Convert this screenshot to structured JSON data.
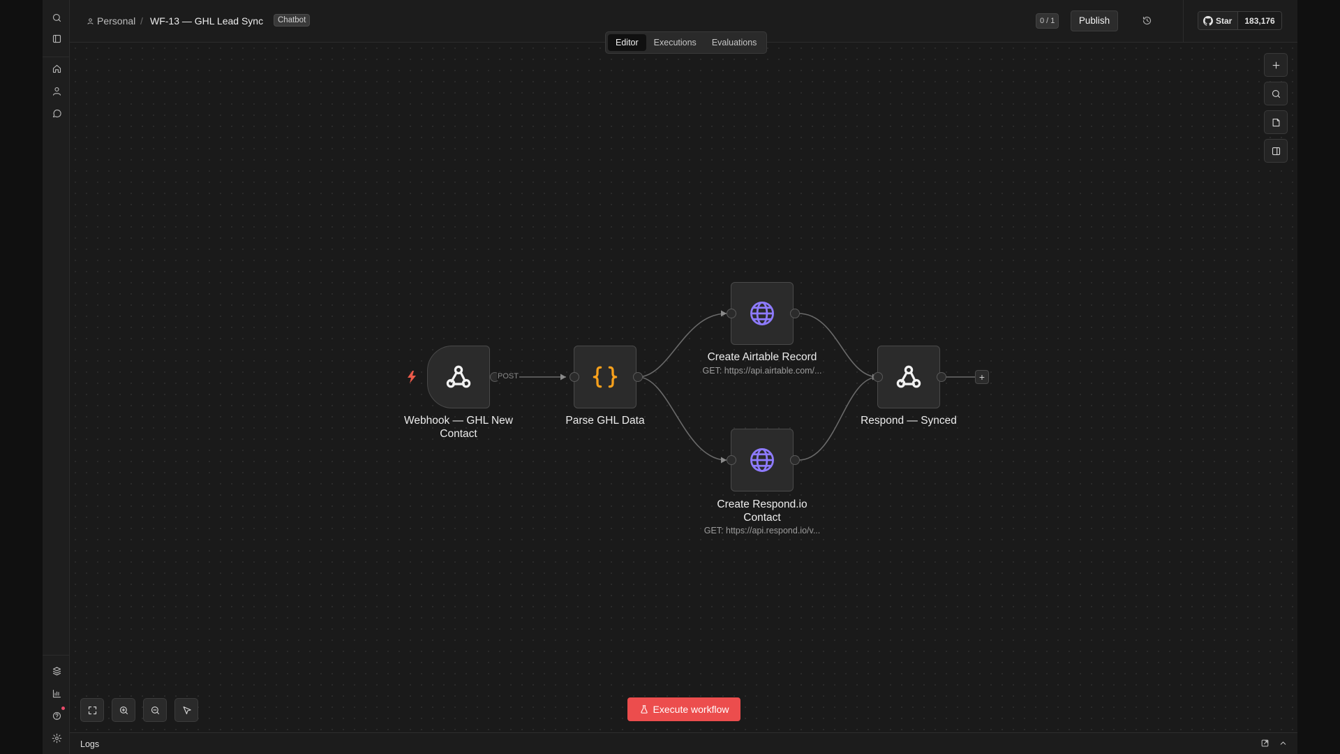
{
  "header": {
    "breadcrumb_owner": "Personal",
    "breadcrumb_separator": "/",
    "workflow_title": "WF-13 — GHL Lead Sync",
    "tag": "Chatbot",
    "version_badge": "0 / 1",
    "publish_label": "Publish",
    "github_star_label": "Star",
    "github_star_count": "183,176"
  },
  "tabs": [
    {
      "label": "Editor",
      "active": true
    },
    {
      "label": "Executions",
      "active": false
    },
    {
      "label": "Evaluations",
      "active": false
    }
  ],
  "sidebar": {
    "top_icons": [
      "search-icon",
      "panel-toggle-icon",
      "home-icon",
      "user-icon",
      "chat-icon"
    ],
    "bottom_icons": [
      "templates-icon",
      "insights-icon",
      "help-icon",
      "settings-icon"
    ]
  },
  "canvas_tools": [
    "add-node-icon",
    "search-icon",
    "sticky-note-icon",
    "panel-icon"
  ],
  "nodes": [
    {
      "id": "webhook",
      "label": "Webhook — GHL New Contact",
      "label_line1": "Webhook — GHL New",
      "label_line2": "Contact",
      "icon": "webhook-icon",
      "trigger": true
    },
    {
      "id": "parse",
      "label": "Parse GHL Data",
      "icon": "code-braces-icon"
    },
    {
      "id": "airtable",
      "label": "Create Airtable Record",
      "subtitle": "GET: https://api.airtable.com/...",
      "icon": "globe-icon"
    },
    {
      "id": "respondio",
      "label": "Create Respond.io Contact",
      "label_line1": "Create Respond.io",
      "label_line2": "Contact",
      "subtitle": "GET: https://api.respond.io/v...",
      "icon": "globe-icon"
    },
    {
      "id": "respond",
      "label": "Respond — Synced",
      "icon": "webhook-icon"
    }
  ],
  "edges": [
    {
      "from": "webhook",
      "to": "parse",
      "label": "POST"
    },
    {
      "from": "parse",
      "to": "airtable"
    },
    {
      "from": "parse",
      "to": "respondio"
    },
    {
      "from": "airtable",
      "to": "respond"
    },
    {
      "from": "respondio",
      "to": "respond"
    }
  ],
  "colors": {
    "accent_execute": "#ec4d4d",
    "trigger_bolt": "#ea5a4a",
    "code_icon": "#f7a01c",
    "globe_icon": "#8e7bff"
  },
  "bottom": {
    "execute_label": "Execute workflow",
    "logs_label": "Logs"
  },
  "zoom_controls": [
    "fit-view-icon",
    "zoom-in-icon",
    "zoom-out-icon",
    "tidy-up-icon"
  ]
}
